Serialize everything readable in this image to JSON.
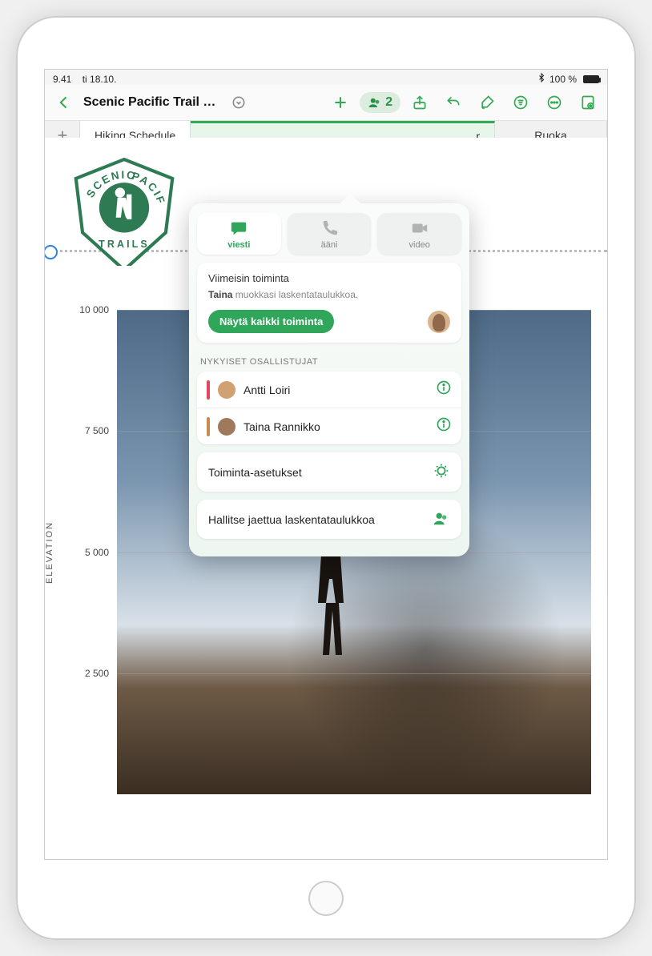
{
  "status": {
    "time": "9.41",
    "date": "ti 18.10.",
    "battery": "100 %",
    "bt_icon": "bluetooth"
  },
  "toolbar": {
    "doc_title": "Scenic Pacific Trail Se...",
    "collab_count": "2"
  },
  "sheet_tabs": [
    "Hiking Schedule",
    "r",
    "Ruoka"
  ],
  "dashed_resize": true,
  "chart_data": {
    "type": "bar",
    "ylabel": "ELEVATION",
    "ylim": [
      0,
      10000
    ],
    "yticks": [
      2500,
      5000,
      7500,
      10000
    ],
    "ytick_labels": [
      "2 500",
      "5 000",
      "7 500",
      "10 000"
    ],
    "categories": [],
    "values": [],
    "note": "Background photo with elevation axis; no bars visible in viewport"
  },
  "badge": {
    "top": "SCENIC",
    "mid": "PACIFIC",
    "bottom": "TRAILS"
  },
  "popover": {
    "tabs": [
      {
        "key": "message",
        "label": "viesti",
        "active": true
      },
      {
        "key": "audio",
        "label": "ääni",
        "active": false
      },
      {
        "key": "video",
        "label": "video",
        "active": false
      }
    ],
    "recent": {
      "heading": "Viimeisin toiminta",
      "who": "Taina",
      "did": "muokkasi laskentataulukkoa.",
      "show_all": "Näytä kaikki toiminta"
    },
    "participants_heading": "NYKYISET OSALLISTUJAT",
    "participants": [
      {
        "name": "Antti Loiri",
        "color": "#e4475d"
      },
      {
        "name": "Taina Rannikko",
        "color": "#c98a4e"
      }
    ],
    "settings_label": "Toiminta-asetukset",
    "manage_label": "Hallitse jaettua laskentataulukkoa"
  }
}
